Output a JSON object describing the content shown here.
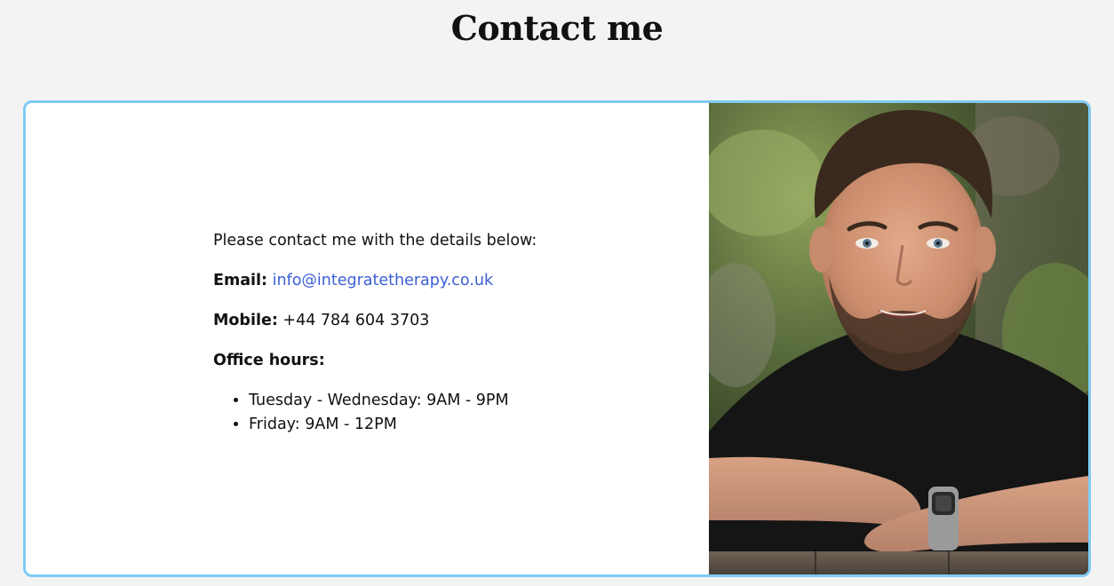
{
  "page": {
    "title": "Contact me"
  },
  "contact": {
    "intro": "Please contact me with the details below:",
    "email_label": "Email:",
    "email_value": "info@integratetherapy.co.uk",
    "mobile_label": "Mobile:",
    "mobile_value": "+44 784 604 3703",
    "hours_label": "Office hours:",
    "hours": [
      "Tuesday - Wednesday: 9AM - 9PM",
      "Friday: 9AM - 12PM"
    ]
  },
  "photo": {
    "icon": "portrait-photo"
  },
  "colors": {
    "background": "#f3f3f3",
    "card_border": "#7fcbf5",
    "link": "#3a5fd6",
    "text": "#111111"
  }
}
